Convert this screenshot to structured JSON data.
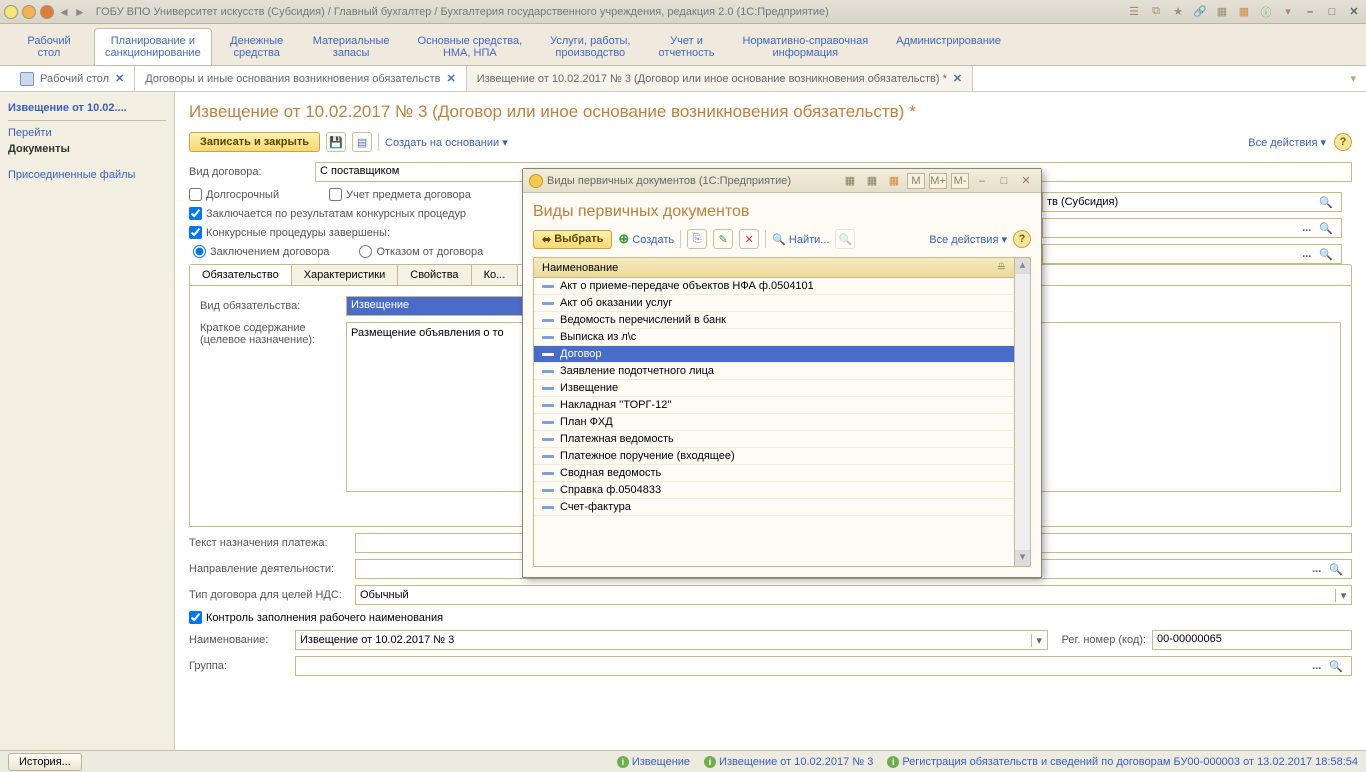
{
  "titlebar": {
    "title": "ГОБУ ВПО Университет искусств (Субсидия) / Главный бухгалтер / Бухгалтерия государственного учреждения, редакция 2.0  (1С:Предприятие)"
  },
  "section_tabs": [
    "Рабочий\nстол",
    "Планирование и\nсанкционирование",
    "Денежные\nсредства",
    "Материальные\nзапасы",
    "Основные средства,\nНМА, НПА",
    "Услуги, работы,\nпроизводство",
    "Учет и\nотчетность",
    "Нормативно-справочная\nинформация",
    "Администрирование"
  ],
  "section_active_index": 1,
  "doc_tabs": [
    {
      "label": "Рабочий стол",
      "icon": true
    },
    {
      "label": "Договоры и иные основания возникновения обязательств"
    },
    {
      "label": "Извещение от 10.02.2017 № 3 (Договор или иное основание возникновения обязательств) *",
      "active": true
    }
  ],
  "leftnav": {
    "heading": "Извещение от 10.02....",
    "go": "Перейти",
    "documents": "Документы",
    "attached": "Присоединенные файлы"
  },
  "main": {
    "title": "Извещение от 10.02.2017 № 3 (Договор или иное основание возникновения обязательств) *",
    "save_close": "Записать и закрыть",
    "create_based": "Создать на основании",
    "all_actions": "Все действия",
    "field_contract_type_label": "Вид договора:",
    "field_contract_type_value": "С поставщиком",
    "cb_longterm": "Долгосрочный",
    "cb_subject": "Учет предмета договора",
    "cb_tender": "Заключается по результатам конкурсных процедур",
    "cb_tender_done": "Конкурсные процедуры завершены:",
    "radio_conclude": "Заключением договора",
    "radio_refuse": "Отказом от договора",
    "inner_tabs": [
      "Обязательство",
      "Характеристики",
      "Свойства",
      "Ко..."
    ],
    "field_obl_type_label": "Вид обязательства:",
    "field_obl_type_value": "Извещение",
    "field_brief_label": "Краткое содержание\n(целевое назначение):",
    "field_brief_value": "Размещение объявления о то",
    "field_payment_label": "Текст назначения платежа:",
    "field_direction_label": "Направление деятельности:",
    "field_vat_label": "Тип договора для целей НДС:",
    "field_vat_value": "Обычный",
    "cb_control_name": "Контроль заполнения рабочего наименования",
    "field_name_label": "Наименование:",
    "field_name_value": "Извещение от 10.02.2017 № 3",
    "field_regnum_label": "Рег. номер (код):",
    "field_regnum_value": "00-00000065",
    "field_group_label": "Группа:",
    "right_field_value": "тв (Субсидия)"
  },
  "modal": {
    "title": "Виды первичных документов  (1С:Предприятие)",
    "heading": "Виды первичных документов",
    "select": "Выбрать",
    "create": "Создать",
    "find": "Найти...",
    "all_actions": "Все действия",
    "column": "Наименование",
    "zoom_icons": [
      "M",
      "M+",
      "M-"
    ],
    "items": [
      "Акт о приеме-передаче объектов НФА ф.0504101",
      "Акт об оказании услуг",
      "Ведомость перечислений в банк",
      "Выписка из л\\с",
      "Договор",
      "Заявление подотчетного лица",
      "Извещение",
      "Накладная ''ТОРГ-12''",
      "План ФХД",
      "Платежная ведомость",
      "Платежное поручение (входящее)",
      "Сводная ведомость",
      "Справка ф.0504833",
      "Счет-фактура"
    ],
    "selected_index": 4
  },
  "statusbar": {
    "history": "История...",
    "link1": "Извещение",
    "link2": "Извещение от 10.02.2017 № 3",
    "link3": "Регистрация обязательств и сведений по договорам БУ00-000003 от 13.02.2017 18:58:54"
  }
}
